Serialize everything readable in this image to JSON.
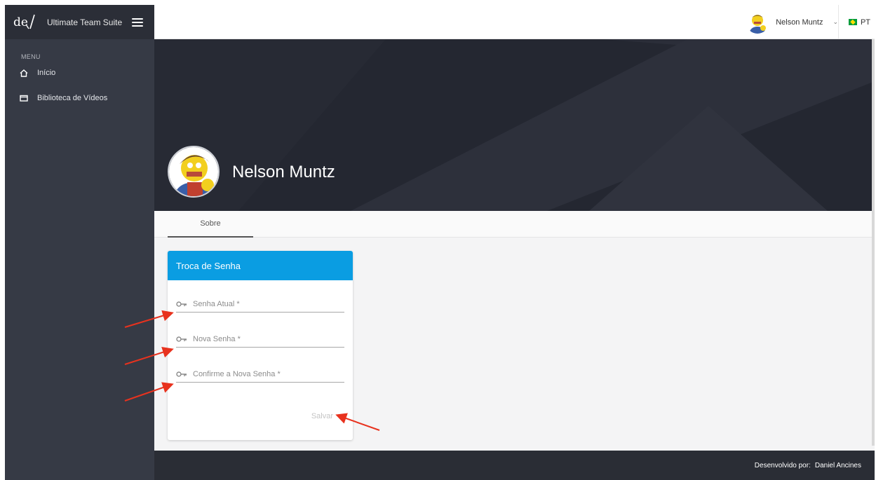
{
  "app": {
    "title": "Ultimate Team Suite",
    "logo_text": "de"
  },
  "sidebar": {
    "menu_label": "MENU",
    "items": [
      {
        "label": "Início",
        "icon": "home-icon"
      },
      {
        "label": "Biblioteca de Vídeos",
        "icon": "film-icon"
      }
    ]
  },
  "header": {
    "user_name": "Nelson Muntz",
    "language": "PT"
  },
  "profile": {
    "name": "Nelson Muntz"
  },
  "tabs": [
    {
      "label": "Sobre",
      "active": true
    }
  ],
  "password_card": {
    "title": "Troca de Senha",
    "fields": [
      {
        "placeholder": "Senha Atual *",
        "value": "",
        "icon": "key-icon"
      },
      {
        "placeholder": "Nova Senha *",
        "value": "",
        "icon": "key-icon"
      },
      {
        "placeholder": "Confirme a Nova Senha *",
        "value": "",
        "icon": "key-icon"
      }
    ],
    "save_label": "Salvar"
  },
  "footer": {
    "label": "Desenvolvido por:",
    "author": "Daniel Ancines"
  },
  "colors": {
    "sidebar": "#363a45",
    "brand_bar": "#2b2e37",
    "card_header": "#0a9de2",
    "banner": "#242731",
    "footer": "#2a2d35",
    "annotation_arrow": "#e8321e"
  }
}
